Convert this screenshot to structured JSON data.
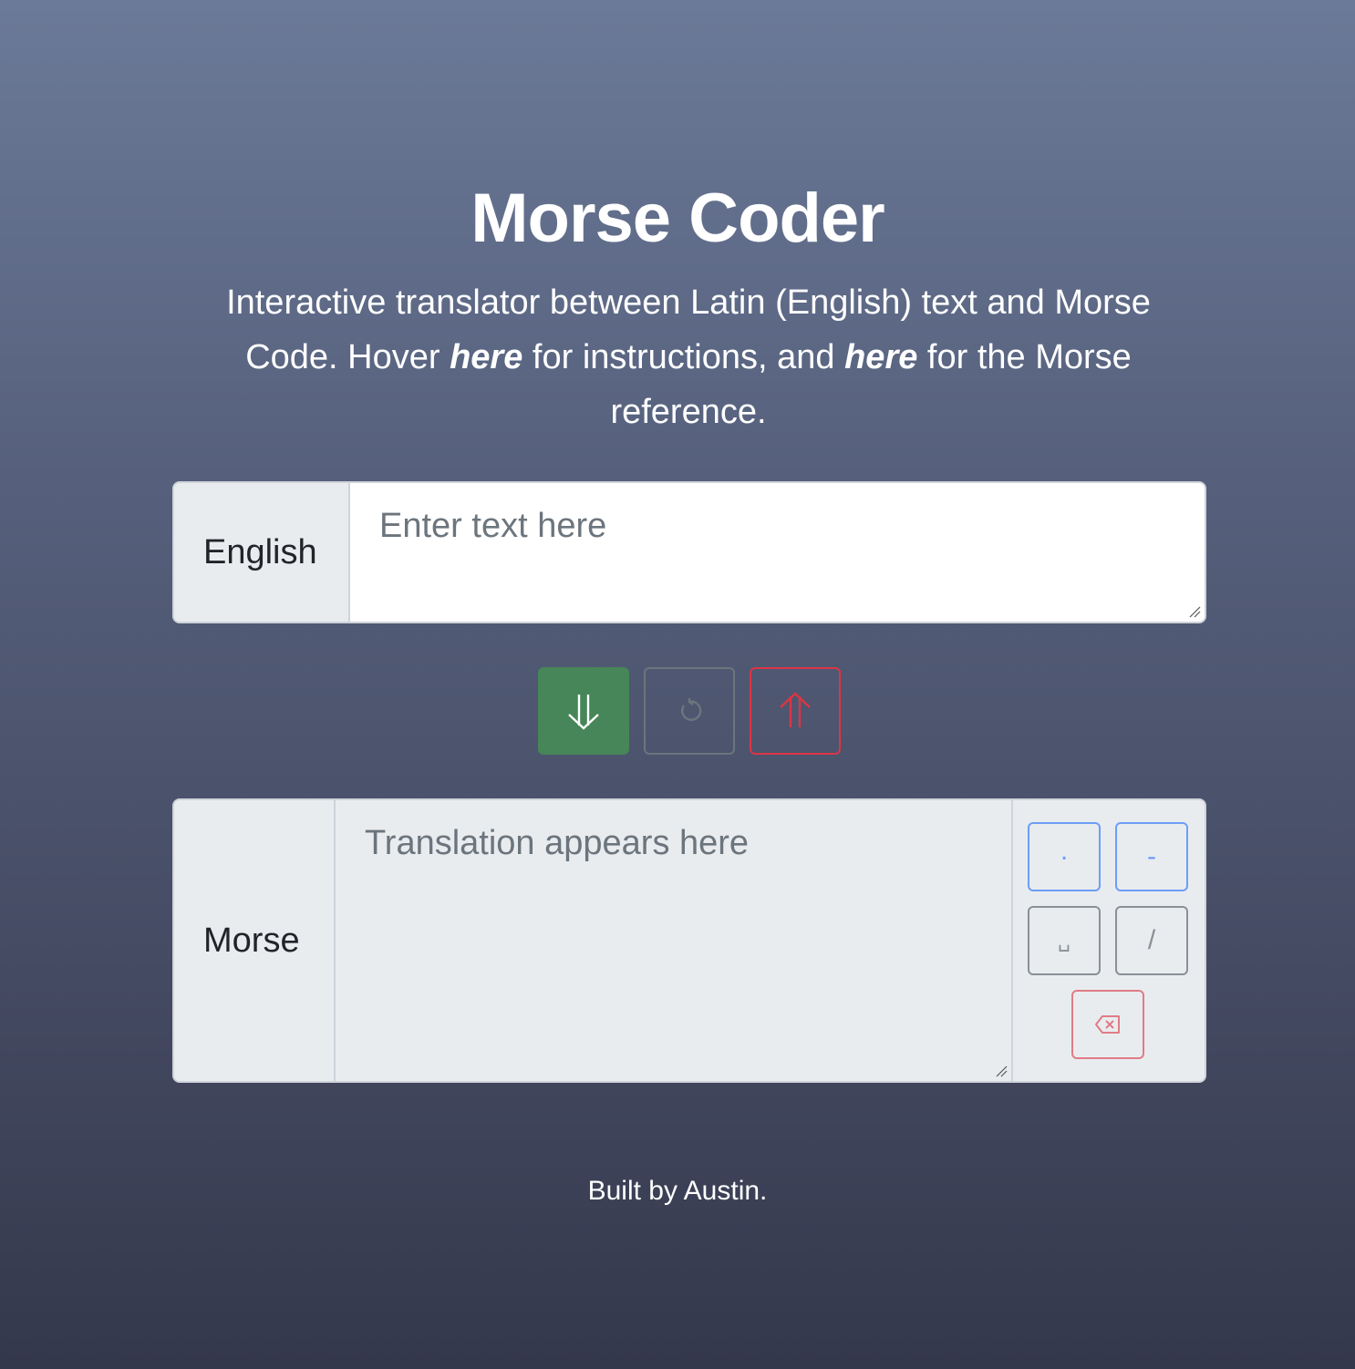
{
  "header": {
    "title": "Morse Coder",
    "intro_part1": "Interactive translator between Latin (English) text and Morse Code. Hover ",
    "intro_link1": "here",
    "intro_part2": " for instructions, and ",
    "intro_link2": "here",
    "intro_part3": " for the Morse reference."
  },
  "english": {
    "label": "English",
    "value": "",
    "placeholder": "Enter text here"
  },
  "actions": {
    "translate_icon": "double-arrow-down-icon",
    "reset_icon": "reset-icon",
    "reverse_icon": "double-arrow-up-icon"
  },
  "morse": {
    "label": "Morse",
    "value": "",
    "placeholder": "Translation appears here"
  },
  "keypad": {
    "dot": ".",
    "dash": "-",
    "space": "␣",
    "slash": "/",
    "backspace_icon": "backspace-icon"
  },
  "footer": {
    "text": "Built by Austin."
  },
  "colors": {
    "primary_green": "#468658",
    "danger_red": "#dc3545",
    "keypad_blue": "#6c9ef8",
    "secondary_gray": "#6c757d"
  }
}
